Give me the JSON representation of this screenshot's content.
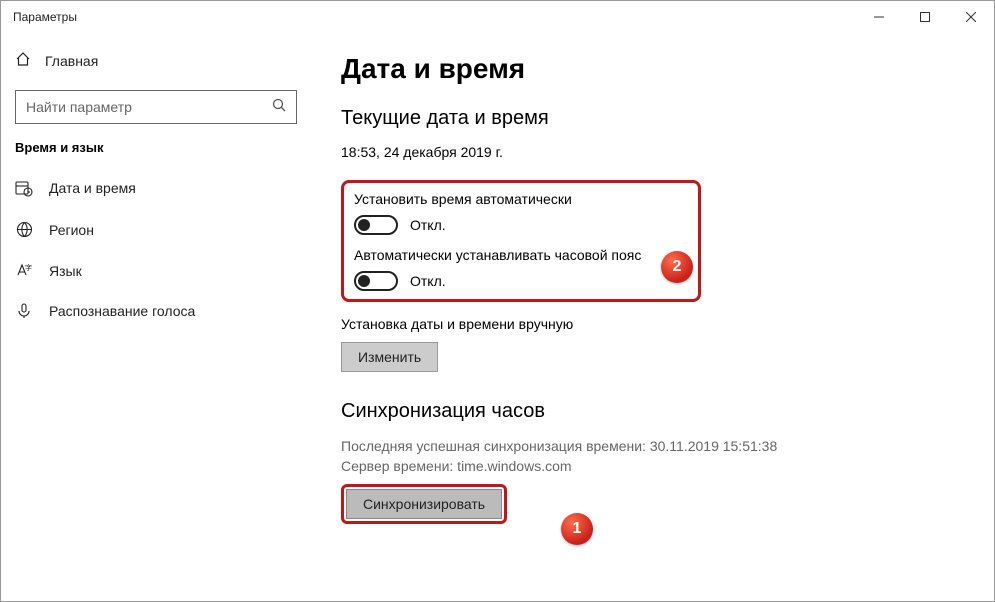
{
  "window": {
    "title": "Параметры"
  },
  "sidebar": {
    "home": "Главная",
    "search_placeholder": "Найти параметр",
    "category": "Время и язык",
    "items": [
      {
        "label": "Дата и время"
      },
      {
        "label": "Регион"
      },
      {
        "label": "Язык"
      },
      {
        "label": "Распознавание голоса"
      }
    ]
  },
  "content": {
    "page_title": "Дата и время",
    "current_section": "Текущие дата и время",
    "current_value": "18:53, 24 декабря 2019 г.",
    "auto_time": {
      "label": "Установить время автоматически",
      "state": "Откл."
    },
    "auto_tz": {
      "label": "Автоматически устанавливать часовой пояс",
      "state": "Откл."
    },
    "manual": {
      "label": "Установка даты и времени вручную",
      "button": "Изменить"
    },
    "sync": {
      "title": "Синхронизация часов",
      "line1": "Последняя успешная синхронизация времени: 30.11.2019 15:51:38",
      "line2": "Сервер времени: time.windows.com",
      "button": "Синхронизировать"
    }
  },
  "badges": {
    "b1": "1",
    "b2": "2"
  }
}
